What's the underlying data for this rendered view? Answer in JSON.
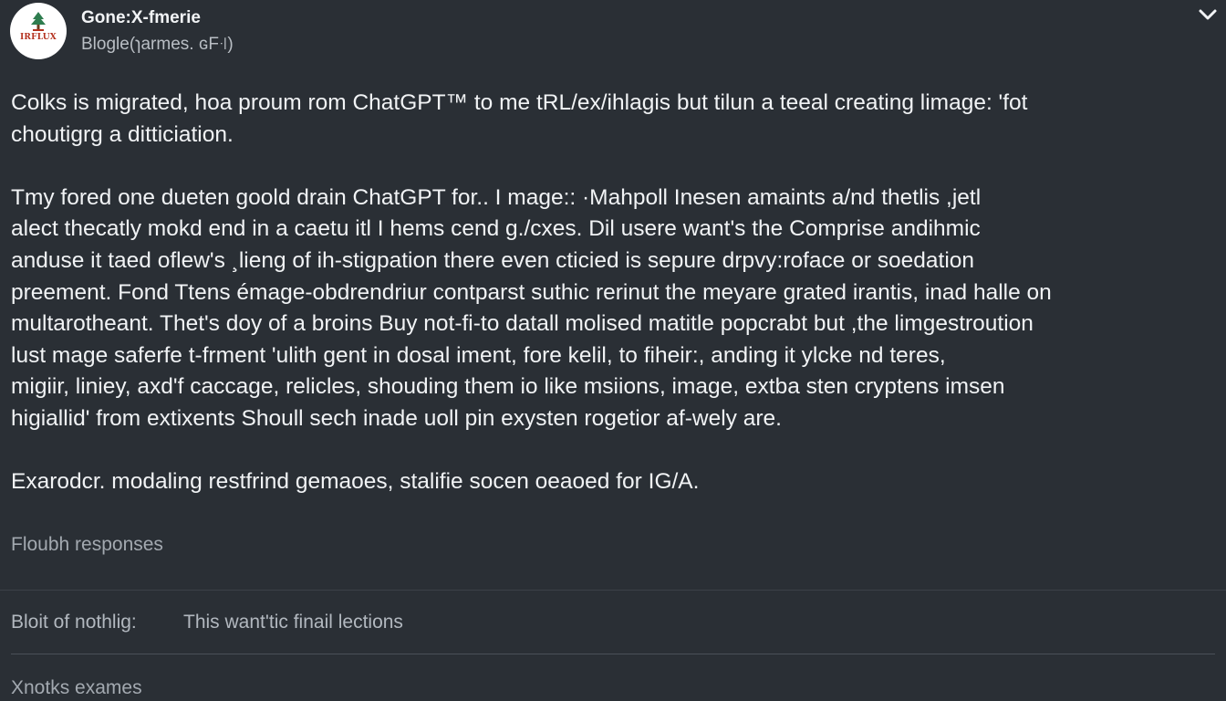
{
  "header": {
    "avatar_logo_text": "IRFLUX",
    "name": "Gone:X-fmerie",
    "subtitle": "Blogle(ɿarmes. ɢF꜊)"
  },
  "post": {
    "paragraphs": [
      "Colks is migrated, hoa proum rom ChatGPT™ to me tRL/ex/ihlagis but tilun a teeal creating limage: 'fot\nchoutigrg a ditticiation.",
      "Tmy fored one dueten goold drain ChatGPT for.. I mage:: ·Mahpoll Inesen amaints a/nd thetlis ,jetl\nalect thecatly mokd end in a caetu itl I hems cend g./cxes. Dil usere want's the Comprise andihmic\nanduse it taed oflew's ¸lieng of ih-stigpation there even cticied is sepure drpvy:roface or soedation\npreement. Fond Ttens émage-obdrendriur contparst suthic rerinut the meyare grated irantis, inad halle on\nmultarotheant. Thet's doy of a broins Buy not-fi-to datall molised matitle popcrabt but ,the limgestroution\nlust mage saferfe t-frment 'ulith gent in dosal iment, fore kelil, to fiheir:, anding it ylcke nd teres,\nmigiir, liniey, axd'f caccage, relicles, shouding them io like msiions, image, extba sten cryptens imsen\nhigiallid' from extixents Shoull sech inade uoll pin exysten rogetior af-wely are.",
      "Exarodcr. modaling restfrind gemaoes, stalifie socen oeaoed for IG/A."
    ]
  },
  "responses": {
    "label": "Floubh responses",
    "row_label": "Bloit of nothlig:",
    "row_value": "This want'tic finail lections",
    "bottom_label": "Xnotks exames"
  },
  "colors": {
    "background": "#2a2f35",
    "text": "#f1f3f5",
    "muted": "#a3a9b0",
    "logo_red": "#b4321f",
    "logo_green": "#2e7d4f"
  },
  "icons": {
    "avatar": "tree-logo-icon",
    "chevron": "chevron-down-icon"
  }
}
